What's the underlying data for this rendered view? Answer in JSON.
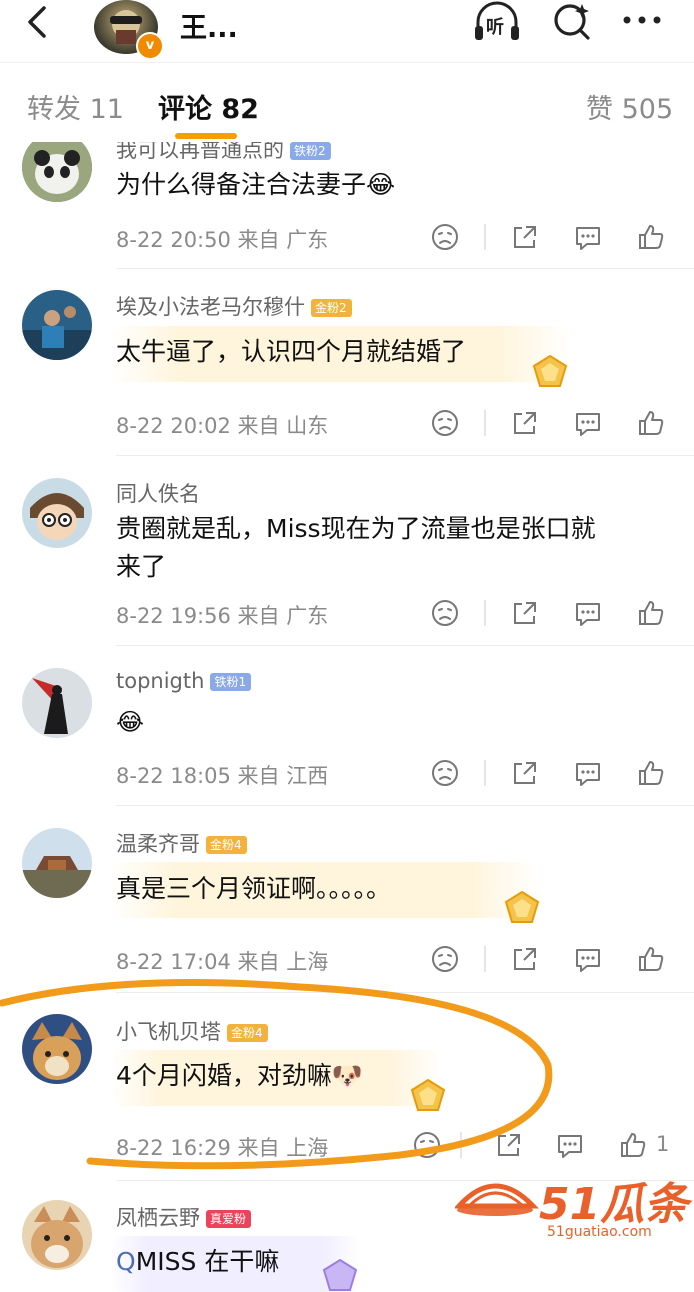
{
  "header": {
    "title": "王...",
    "listen_label": "听"
  },
  "tabs": [
    {
      "label": "转发 11"
    },
    {
      "label": "评论 82"
    },
    {
      "label": "赞 505"
    }
  ],
  "comments": [
    {
      "name": "我可以再普通点的",
      "badge": "铁粉2",
      "text": "为什么得备注合法妻子😂",
      "time": "8-22 20:50",
      "location": "来自 广东",
      "likes": ""
    },
    {
      "name": "埃及小法老马尔穆什",
      "badge": "金粉2",
      "text": "太牛逼了，认识四个月就结婚了",
      "time": "8-22 20:02",
      "location": "来自 山东",
      "likes": ""
    },
    {
      "name": "同人佚名",
      "badge": "",
      "text_line1": "贵圈就是乱，Miss现在为了流量也是张口就",
      "text_line2": "来了",
      "time": "8-22 19:56",
      "location": "来自 广东",
      "likes": ""
    },
    {
      "name": "topnigth",
      "badge": "铁粉1",
      "text": "😂",
      "time": "8-22 18:05",
      "location": "来自 江西",
      "likes": ""
    },
    {
      "name": "温柔齐哥",
      "badge": "金粉4",
      "text": "真是三个月领证啊。。。。。",
      "time": "8-22 17:04",
      "location": "来自 上海",
      "likes": ""
    },
    {
      "name": "小飞机贝塔",
      "badge": "金粉4",
      "text": "4个月闪婚，对劲嘛🐶",
      "time": "8-22 16:29",
      "location": "来自 上海",
      "likes": "1"
    },
    {
      "name": "凤栖云野",
      "badge": "真爱粉",
      "text_prefix": "Q",
      "text": "MISS 在干嘛"
    }
  ],
  "watermark": {
    "brand": "51瓜条",
    "url": "51guatiao.com"
  },
  "colors": {
    "accent": "#f5a000",
    "gold_badge": "#f2b33d",
    "iron_badge": "#8aa9e8",
    "love_badge": "#e9445a",
    "highlight_circle": "#f29a1a"
  }
}
